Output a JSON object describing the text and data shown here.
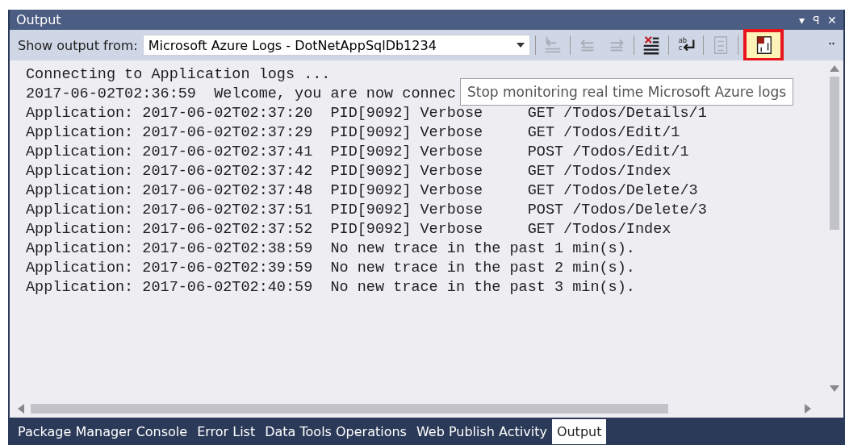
{
  "panel": {
    "title": "Output",
    "controls": [
      "▾",
      "ꟼ",
      "✕"
    ]
  },
  "toolbar": {
    "label": "Show output from:",
    "source": "Microsoft Azure Logs - DotNetAppSqlDb1234",
    "buttons": [
      {
        "kind": "goto",
        "disabled": true,
        "highlighted": false
      },
      {
        "kind": "prev",
        "disabled": true,
        "highlighted": false
      },
      {
        "kind": "next",
        "disabled": true,
        "highlighted": false
      },
      {
        "kind": "clear",
        "disabled": false,
        "highlighted": false
      },
      {
        "kind": "wrap",
        "disabled": false,
        "highlighted": false,
        "glyphs": [
          "ab",
          "c"
        ]
      },
      {
        "kind": "list",
        "disabled": true,
        "highlighted": false
      },
      {
        "kind": "stop",
        "disabled": false,
        "highlighted": true
      }
    ],
    "tooltip": "Stop monitoring real time Microsoft Azure logs"
  },
  "lines": [
    "Connecting to Application logs ...",
    "2017-06-02T02:36:59  Welcome, you are now connec",
    "Application: 2017-06-02T02:37:20  PID[9092] Verbose     GET /Todos/Details/1",
    "Application: 2017-06-02T02:37:29  PID[9092] Verbose     GET /Todos/Edit/1",
    "Application: 2017-06-02T02:37:41  PID[9092] Verbose     POST /Todos/Edit/1",
    "Application: 2017-06-02T02:37:42  PID[9092] Verbose     GET /Todos/Index",
    "Application: 2017-06-02T02:37:48  PID[9092] Verbose     GET /Todos/Delete/3",
    "Application: 2017-06-02T02:37:51  PID[9092] Verbose     POST /Todos/Delete/3",
    "Application: 2017-06-02T02:37:52  PID[9092] Verbose     GET /Todos/Index",
    "Application: 2017-06-02T02:38:59  No new trace in the past 1 min(s).",
    "Application: 2017-06-02T02:39:59  No new trace in the past 2 min(s).",
    "Application: 2017-06-02T02:40:59  No new trace in the past 3 min(s)."
  ],
  "tabs": [
    {
      "label": "Package Manager Console",
      "selected": false
    },
    {
      "label": "Error List",
      "selected": false
    },
    {
      "label": "Data Tools Operations",
      "selected": false
    },
    {
      "label": "Web Publish Activity",
      "selected": false
    },
    {
      "label": "Output",
      "selected": true
    }
  ]
}
